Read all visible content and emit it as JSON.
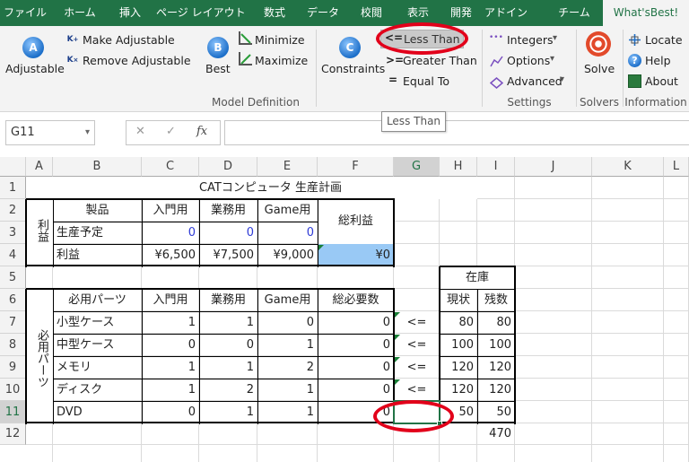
{
  "ribbon_tabs": [
    {
      "label": "ファイル",
      "active": false
    },
    {
      "label": "ホーム",
      "active": false
    },
    {
      "label": "挿入",
      "active": false
    },
    {
      "label": "ページ レイアウト",
      "active": false
    },
    {
      "label": "数式",
      "active": false
    },
    {
      "label": "データ",
      "active": false
    },
    {
      "label": "校閲",
      "active": false
    },
    {
      "label": "表示",
      "active": false
    },
    {
      "label": "開発",
      "active": false
    },
    {
      "label": "アドイン",
      "active": false
    },
    {
      "label": "チーム",
      "active": false
    },
    {
      "label": "What'sBest!",
      "active": true
    }
  ],
  "ribbon": {
    "adjustable": "Adjustable",
    "make_adjustable": "Make Adjustable",
    "remove_adjustable": "Remove Adjustable",
    "best": "Best",
    "minimize": "Minimize",
    "maximize": "Maximize",
    "constraints": "Constraints",
    "less_than": "Less Than",
    "greater_than": "Greater Than",
    "equal_to": "Equal To",
    "less_than_symbol": "<=",
    "greater_than_symbol": ">=",
    "equal_to_symbol": "=",
    "integers": "Integers",
    "options": "Options",
    "advanced": "Advanced",
    "solve": "Solve",
    "locate": "Locate",
    "help": "Help",
    "about": "About",
    "group_model": "Model Definition",
    "group_settings": "Settings",
    "group_solvers": "Solvers",
    "group_information": "Information",
    "tooltip": "Less Than",
    "icon_adjustable_letter": "A",
    "icon_best_letter": "B",
    "icon_constraints_letter": "C",
    "icon_integers": "•••",
    "icon_help": "?",
    "dropdown_arrow": "▾"
  },
  "formula_bar": {
    "name_box": "G11",
    "cancel": "✕",
    "enter": "✓",
    "fx": "fx",
    "formula": ""
  },
  "columns": [
    "A",
    "B",
    "C",
    "D",
    "E",
    "F",
    "G",
    "H",
    "I",
    "J",
    "K",
    "L"
  ],
  "rows": [
    "1",
    "2",
    "3",
    "4",
    "5",
    "6",
    "7",
    "8",
    "9",
    "10",
    "11",
    "12"
  ],
  "sheet": {
    "title": "CATコンピュータ 生産計画",
    "profit_vertical": "利益",
    "parts_vertical": "必用パーツ",
    "header_product": "製品",
    "header_entry": "入門用",
    "header_business": "業務用",
    "header_game": "Game用",
    "header_total_profit": "総利益",
    "row3_label": "生産予定",
    "row3": [
      "0",
      "0",
      "0"
    ],
    "row4_label": "利益",
    "row4": [
      "¥6,500",
      "¥7,500",
      "¥9,000"
    ],
    "total_profit_value": "¥0",
    "inventory": "在庫",
    "header_parts": "必用パーツ",
    "header_total_required": "総必要数",
    "header_current": "現状",
    "header_remaining": "残数",
    "parts": [
      {
        "name": "小型ケース",
        "c": "1",
        "d": "1",
        "e": "0",
        "f": "0",
        "g": "<=",
        "h": "80",
        "i": "80"
      },
      {
        "name": "中型ケース",
        "c": "0",
        "d": "0",
        "e": "1",
        "f": "0",
        "g": "<=",
        "h": "100",
        "i": "100"
      },
      {
        "name": "メモリ",
        "c": "1",
        "d": "1",
        "e": "2",
        "f": "0",
        "g": "<=",
        "h": "120",
        "i": "120"
      },
      {
        "name": "ディスク",
        "c": "1",
        "d": "2",
        "e": "1",
        "f": "0",
        "g": "<=",
        "h": "120",
        "i": "120"
      },
      {
        "name": "DVD",
        "c": "0",
        "d": "1",
        "e": "1",
        "f": "0",
        "g": "",
        "h": "50",
        "i": "50"
      }
    ],
    "total_inventory": "470"
  },
  "colors": {
    "accent": "#217346",
    "blue_value": "#2f3bd6",
    "highlight": "#99c9f5",
    "annotation": "#e2001a"
  }
}
